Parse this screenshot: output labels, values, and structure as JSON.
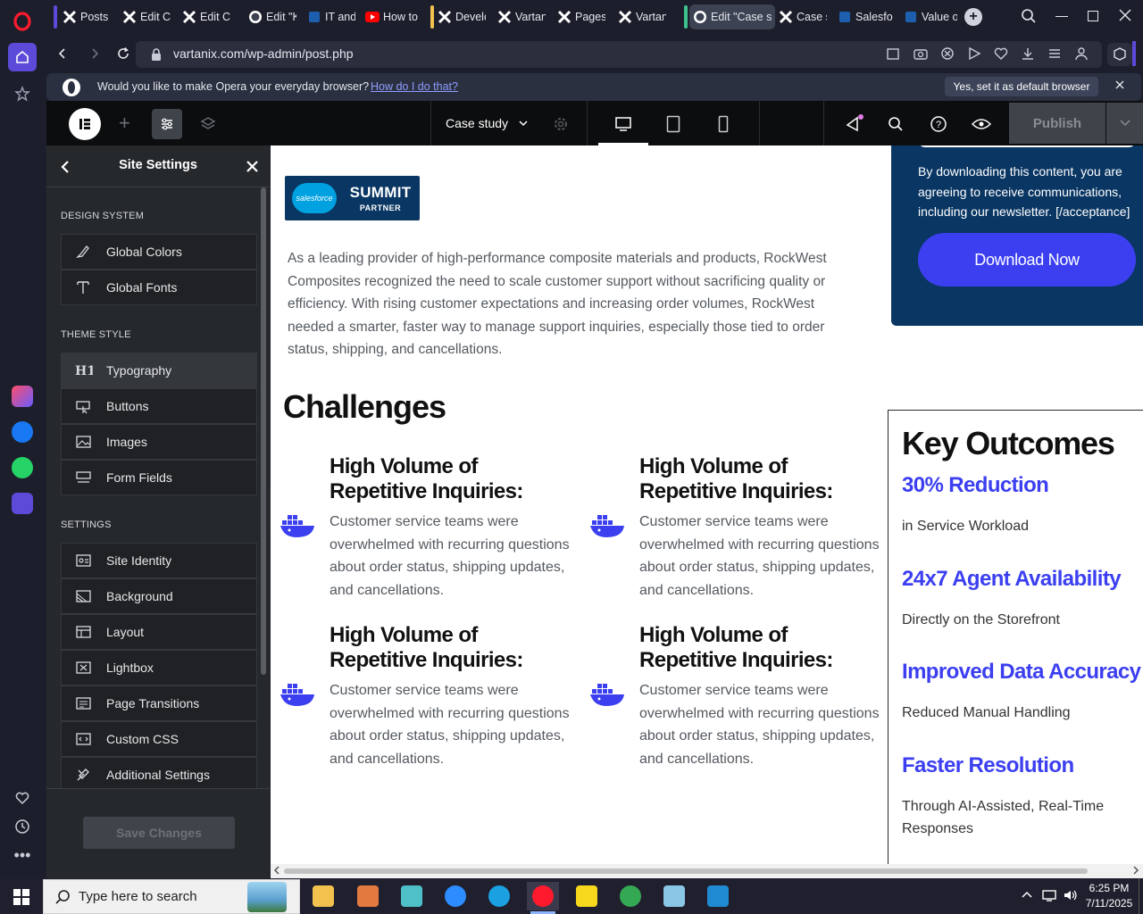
{
  "browser": {
    "tabs": [
      {
        "title": "Posts ‹",
        "icon": "x-logo-icon"
      },
      {
        "title": "Edit Co",
        "icon": "x-logo-icon"
      },
      {
        "title": "Edit Co",
        "icon": "x-logo-icon"
      },
      {
        "title": "Edit \"K",
        "icon": "wordpress-icon"
      },
      {
        "title": "IT and",
        "icon": "bookmark-icon"
      },
      {
        "title": "How to",
        "icon": "youtube-icon"
      },
      {
        "title": "Develo",
        "icon": "x-logo-icon"
      },
      {
        "title": "Vartan",
        "icon": "x-logo-icon"
      },
      {
        "title": "Pages",
        "icon": "x-logo-icon"
      },
      {
        "title": "Vartan",
        "icon": "x-logo-icon"
      },
      {
        "title": "Edit \"Case st",
        "icon": "wordpress-icon"
      },
      {
        "title": "Case st",
        "icon": "x-logo-icon"
      },
      {
        "title": "Salesfo",
        "icon": "bookmark-icon"
      },
      {
        "title": "Value o",
        "icon": "bookmark-icon"
      }
    ],
    "url": "vartanix.com/wp-admin/post.php",
    "infobar": {
      "message": "Would you like to make Opera your everyday browser?",
      "link": "How do I do that?",
      "button": "Yes, set it as default browser"
    }
  },
  "editor": {
    "page_name": "Case study",
    "publish": "Publish",
    "panel": {
      "title": "Site Settings",
      "sections": [
        {
          "title": "DESIGN SYSTEM",
          "items": [
            {
              "label": "Global Colors",
              "icon": "brush-icon"
            },
            {
              "label": "Global Fonts",
              "icon": "font-icon"
            }
          ]
        },
        {
          "title": "THEME STYLE",
          "items": [
            {
              "label": "Typography",
              "icon": "heading-icon"
            },
            {
              "label": "Buttons",
              "icon": "button-icon"
            },
            {
              "label": "Images",
              "icon": "image-icon"
            },
            {
              "label": "Form Fields",
              "icon": "form-icon"
            }
          ]
        },
        {
          "title": "SETTINGS",
          "items": [
            {
              "label": "Site Identity",
              "icon": "site-identity-icon"
            },
            {
              "label": "Background",
              "icon": "background-icon"
            },
            {
              "label": "Layout",
              "icon": "layout-icon"
            },
            {
              "label": "Lightbox",
              "icon": "lightbox-icon"
            },
            {
              "label": "Page Transitions",
              "icon": "transitions-icon"
            },
            {
              "label": "Custom CSS",
              "icon": "code-icon"
            },
            {
              "label": "Additional Settings",
              "icon": "tools-icon"
            }
          ]
        }
      ],
      "save": "Save Changes"
    }
  },
  "page": {
    "badge": {
      "brand": "salesforce",
      "title": "SUMMIT",
      "subtitle": "PARTNER"
    },
    "intro": "As a leading provider of high-performance composite materials and products, RockWest Composites recognized the need to scale customer support without sacrificing quality or efficiency. With rising customer expectations and increasing order volumes, RockWest needed a smarter, faster way to manage support inquiries, especially those tied to order status, shipping, and cancellations.",
    "challenges_heading": "Challenges",
    "challenges": [
      {
        "title": "High Volume of Repetitive Inquiries:",
        "text": "Customer service teams were overwhelmed with recurring questions about order status, shipping updates, and cancellations."
      },
      {
        "title": "High Volume of Repetitive Inquiries:",
        "text": "Customer service teams were overwhelmed with recurring questions about order status, shipping updates, and cancellations."
      },
      {
        "title": "High Volume of Repetitive Inquiries:",
        "text": "Customer service teams were overwhelmed with recurring questions about order status, shipping updates, and cancellations."
      },
      {
        "title": "High Volume of Repetitive Inquiries:",
        "text": "Customer service teams were overwhelmed with recurring questions about order status, shipping updates, and cancellations."
      }
    ],
    "download_box": {
      "consent": "By downloading this content, you are agreeing to receive communications, including our newsletter. [/acceptance]",
      "button": "Download Now"
    },
    "outcomes": {
      "heading": "Key Outcomes",
      "items": [
        {
          "value": "30% Reduction",
          "desc": "in Service Workload"
        },
        {
          "value": "24x7 Agent Availability",
          "desc": "Directly on the Storefront"
        },
        {
          "value": "Improved Data Accuracy",
          "desc": "Reduced Manual Handling"
        },
        {
          "value": "Faster Resolution",
          "desc": "Through AI-Assisted, Real-Time Responses"
        }
      ]
    }
  },
  "taskbar": {
    "search_placeholder": "Type here to search",
    "time": "6:25 PM",
    "date": "7/11/2025"
  },
  "colors": {
    "accent": "#3b3ff0",
    "brand_navy": "#0a3663",
    "opera_red": "#ff1b2d",
    "elementor_panel": "#26292c"
  }
}
